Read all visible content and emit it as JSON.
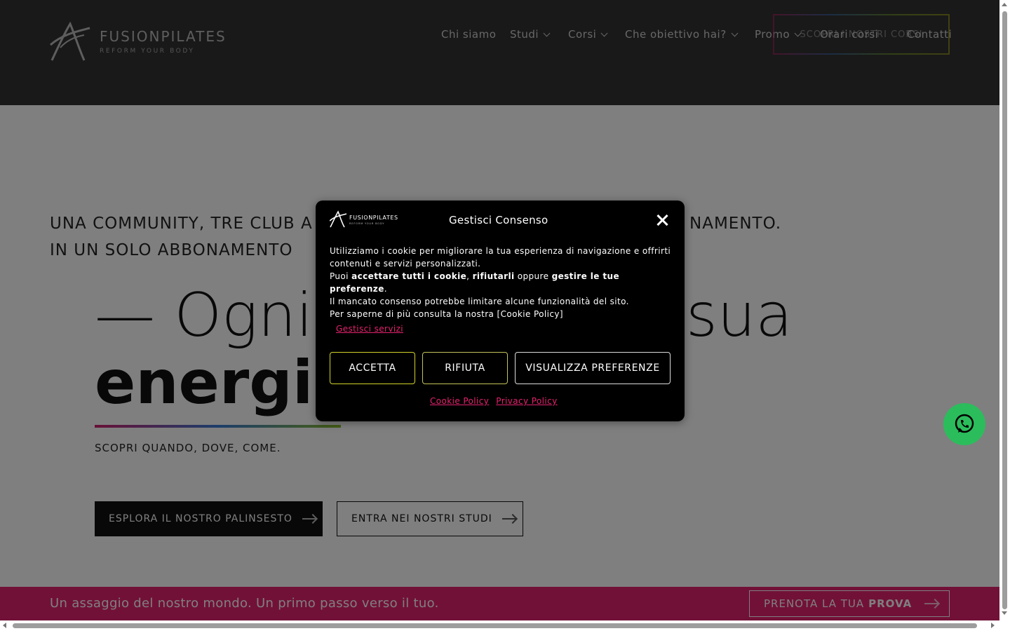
{
  "header": {
    "logo_word": "FUSIONPILATES",
    "logo_tagline": "REFORM YOUR BODY",
    "nav": [
      {
        "label": "Chi siamo",
        "dropdown": false
      },
      {
        "label": "Studi",
        "dropdown": true
      },
      {
        "label": "Corsi",
        "dropdown": true
      },
      {
        "label": "Che obiettivo hai?",
        "dropdown": true
      },
      {
        "label": "Promo",
        "dropdown": true
      },
      {
        "label": "Orari corsi",
        "dropdown": false
      },
      {
        "label": "Contatti",
        "dropdown": false
      }
    ],
    "cta_label": "SCOPRI I NOSTRI CORSI"
  },
  "hero": {
    "subtitle_line1": "UNA COMMUNITY, TRE CLUB A",
    "subtitle_line1_end": "NAMENTO.",
    "subtitle_line2": "IN UN SOLO ABBONAMENTO",
    "title_part1": "— Ogni",
    "title_part2": "sua",
    "title_bold": "energia",
    "small_text": "SCOPRI QUANDO, DOVE, COME.",
    "button_primary": "ESPLORA IL NOSTRO PALINSESTO",
    "button_secondary": "ENTRA NEI NOSTRI STUDI"
  },
  "promo_bar": {
    "text": "Un assaggio del nostro mondo. Un primo passo verso il tuo.",
    "button_prefix": "PRENOTA LA TUA",
    "button_bold": "PROVA"
  },
  "cookie_modal": {
    "logo_word": "FUSIONPILATES",
    "logo_tagline": "REFORM YOUR BODY",
    "title": "Gestisci Consenso",
    "line1": "Utilizziamo i cookie per migliorare la tua esperienza di navigazione e offrirti contenuti e servizi personalizzati.",
    "line2_a": "Puoi ",
    "line2_b": "accettare tutti i cookie",
    "line2_c": ", ",
    "line2_d": "rifiutarli",
    "line2_e": " oppure ",
    "line2_f": "gestire le tue preferenze",
    "line2_g": ".",
    "line3": "Il mancato consenso potrebbe limitare alcune funzionalità del sito.",
    "line4": "Per saperne di più consulta la nostra [Cookie Policy]",
    "manage_services": "Gestisci servizi",
    "accept": "ACCETTA",
    "reject": "RIFIUTA",
    "preferences": "VISUALIZZA PREFERENZE",
    "cookie_policy": "Cookie Policy",
    "privacy_policy": "Privacy Policy"
  },
  "colors": {
    "accent_pink": "#e5226e",
    "whatsapp_green": "#2bbd5c"
  }
}
